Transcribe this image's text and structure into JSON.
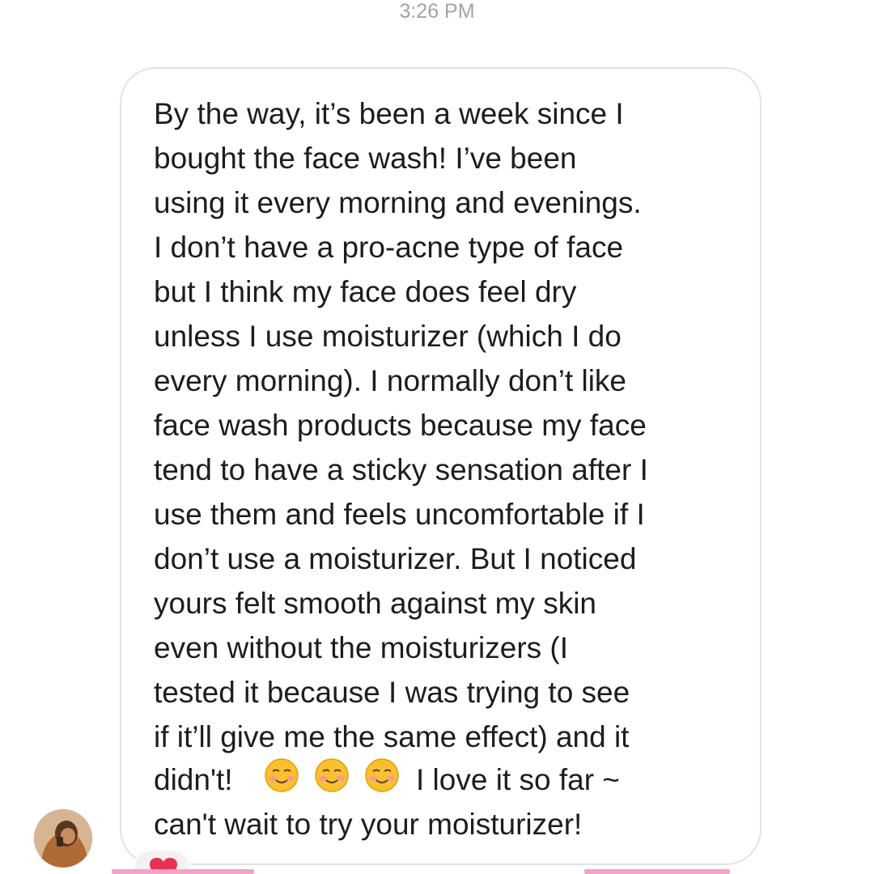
{
  "timestamp": "3:26 PM",
  "message": {
    "lines": [
      "By the way, it’s been a week since I",
      "bought the face wash! I’ve been",
      "using it every morning and evenings.",
      "I don’t have a pro-acne type of face",
      "but I think my face does feel dry",
      "unless I use moisturizer (which I do",
      "every morning). I normally don’t like",
      "face wash products because my face",
      "tend to have a sticky sensation after I",
      "use them and feels uncomfortable if I",
      "don’t use a moisturizer. But I noticed",
      "yours felt smooth against my skin",
      "even without the moisturizers (I",
      "tested it because I was trying to see",
      "if it’ll give me the same effect) and it"
    ],
    "line16_start": "didn't!",
    "line16_end": "I love it so far ~",
    "line17": "can't wait to try your moisturizer!",
    "emojis": [
      "smiling-face-icon",
      "smiling-face-icon",
      "smiling-face-icon"
    ]
  },
  "reaction": {
    "icon": "heart-icon",
    "color": "#e8314f"
  },
  "colors": {
    "bubble_border": "#e3e3e3",
    "text": "#1d1d1d",
    "timestamp": "#a3a3a3",
    "accent_pink": "#f4a3c8"
  }
}
